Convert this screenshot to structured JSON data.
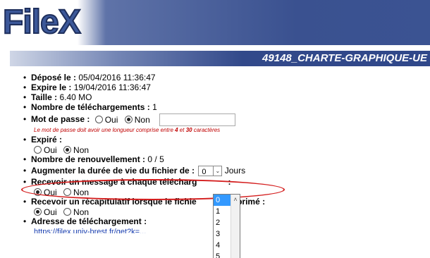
{
  "app": {
    "logo_text": "FileX"
  },
  "file": {
    "title": "49148_CHARTE-GRAPHIQUE-UE"
  },
  "details": {
    "deposited_label": "Déposé le :",
    "deposited_value": "05/04/2016 11:36:47",
    "expires_label": "Expire le :",
    "expires_value": "19/04/2016 11:36:47",
    "size_label": "Taille :",
    "size_value": "6.40 MO",
    "downloads_label": "Nombre de téléchargements :",
    "downloads_value": "1",
    "password_label": "Mot de passe :",
    "password_yes": "Oui",
    "password_no": "Non",
    "password_hint_a": "Le mot de passe doit avoir une longueur comprise entre ",
    "password_hint_min": "4",
    "password_hint_b": " et ",
    "password_hint_max": "30",
    "password_hint_c": " caractères",
    "expired_label": "Expiré :",
    "expired_yes": "Oui",
    "expired_no": "Non",
    "renewals_label": "Nombre de renouvellement :",
    "renewals_value": "0 / 5",
    "extend_label": "Augmenter la durée de vie du fichier de :",
    "extend_selected": "0",
    "extend_unit": "Jours",
    "notify_label_left": "Recevoir un message à chaque télécharg",
    "notify_label_right": ":",
    "notify_yes": "Oui",
    "notify_no": "Non",
    "summary_label_left": "Recevoir un récapitulatif lorsque le fichie",
    "summary_label_right": "supprimé :",
    "summary_yes": "Oui",
    "summary_no": "Non",
    "download_address_label": "Adresse de téléchargement :",
    "download_address_partial": "https://filex.univ-brest.fr/get?k=..."
  },
  "dropdown": {
    "options": [
      "0",
      "1",
      "2",
      "3",
      "4",
      "5"
    ]
  },
  "colors": {
    "header_blue": "#3a5190",
    "annotation_red": "#d41e1e",
    "hint_red": "#c00000",
    "selected_option": "#3399ff"
  }
}
